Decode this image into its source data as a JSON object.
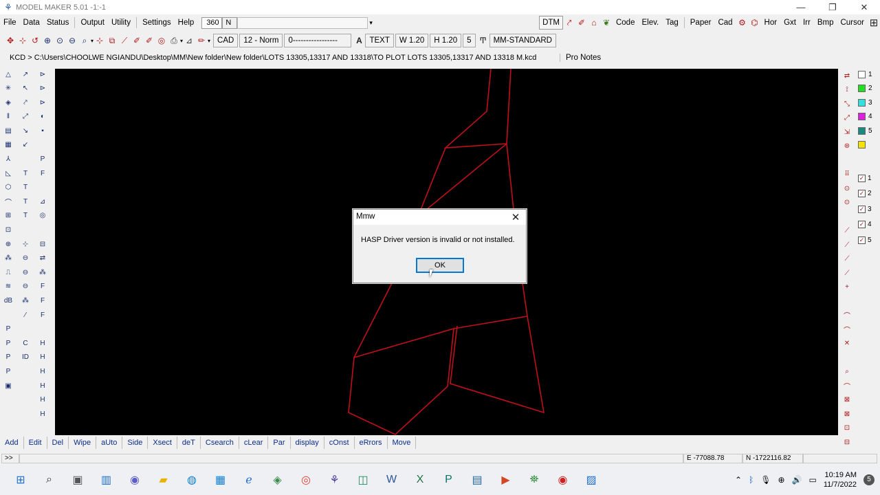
{
  "window": {
    "title": "MODEL MAKER  5.01    -1:-1",
    "app_icon": "model-maker-logo-icon",
    "controls": [
      "—",
      "❐",
      "✕"
    ]
  },
  "menubar": {
    "items": [
      "File",
      "Data",
      "Status",
      "Output",
      "Utility",
      "Settings",
      "Help"
    ],
    "zoom_value": "360",
    "north_value": "N"
  },
  "right_toolbar": {
    "dtm": "DTM",
    "code": "Code",
    "elev": "Elev.",
    "tag": "Tag",
    "paper": "Paper",
    "cad": "Cad",
    "hor": "Hor",
    "gxt": "Gxt",
    "irr": "Irr",
    "bmp": "Bmp",
    "cursor": "Cursor"
  },
  "toolbar2": {
    "cad_label": "CAD",
    "pen_label": "12 - Norm",
    "linestyle": "0-----------------",
    "text_label": "TEXT",
    "width_label": "W 1.20",
    "height_label": "H 1.20",
    "digits": "5",
    "style_label": "MM-STANDARD"
  },
  "pathbar": {
    "path": "KCD > C:\\Users\\CHOOLWE NGIANDU\\Desktop\\MM\\New folder\\New folder\\LOTS 13305,13317 AND 13318\\TO PLOT LOTS 13305,13317 AND 13318 M.kcd",
    "pro_notes": "Pro Notes"
  },
  "left_tools_a": [
    "△",
    "✳",
    "◈",
    "‖",
    "▤",
    "▦",
    "⅄",
    "◺",
    "⬡",
    "⌒",
    "⊞",
    "⊡",
    "⊕",
    "⁂",
    "⎍",
    "≋",
    "dB",
    "",
    "P",
    "P",
    "P",
    "P",
    "▣"
  ],
  "left_tools_b": [
    "↗",
    "↖",
    "⤤",
    "⤢",
    "↘",
    "↙",
    "",
    "T",
    "T",
    "T",
    "T",
    "",
    "⊹",
    "⊖",
    "⊖",
    "⊖",
    "⁂",
    "⁄",
    "",
    "C",
    "ID",
    "",
    ""
  ],
  "left_tools_c": [
    "⊳",
    "⊳",
    "⊳",
    "◐",
    "▪",
    "",
    "P",
    "F",
    "",
    "⊿",
    "◎",
    "",
    "⊟",
    "⇄",
    "⁂",
    "F",
    "F",
    "F",
    "",
    "H",
    "H",
    "H",
    "H",
    "H",
    "H"
  ],
  "right_tools": [
    "⇄",
    "⟟",
    "⤡",
    "⤢",
    "⇲",
    "⊛",
    "",
    "⠿",
    "⊙",
    "⊙",
    "",
    "⟋",
    "⟋",
    "⟋",
    "⟋",
    "+",
    "",
    "⌒",
    "⌒",
    "✕",
    "",
    "⌕",
    "⌒",
    "⊠",
    "⊠",
    "⊡",
    "⊟"
  ],
  "layers": [
    {
      "num": "1",
      "color": "#ffffff"
    },
    {
      "num": "2",
      "color": "#22dd22"
    },
    {
      "num": "3",
      "color": "#33e0e0"
    },
    {
      "num": "4",
      "color": "#dd22dd"
    },
    {
      "num": "5",
      "color": "#1a8a80"
    },
    {
      "num": "",
      "color": "#f5e200"
    }
  ],
  "checks": [
    "1",
    "2",
    "3",
    "4",
    "5"
  ],
  "plot": {
    "line_color": "#c0101a",
    "background": "#000000"
  },
  "command_buttons": [
    "Add",
    "Edit",
    "Del",
    "Wipe",
    "aUto",
    "Side",
    "Xsect",
    "deT",
    "Csearch",
    "cLear",
    "Par",
    "display",
    "cOnst",
    "eRrors",
    "Move"
  ],
  "status": {
    "prompt": ">>",
    "easting": "E -77088.78",
    "northing": "N -1722116.82"
  },
  "dialog": {
    "title": "Mmw",
    "message": "HASP Driver version is invalid or not installed.",
    "ok_label": "OK"
  },
  "taskbar": {
    "apps": [
      "windows-start-icon",
      "search-icon",
      "task-view-icon",
      "widgets-icon",
      "teams-chat-icon",
      "file-explorer-icon",
      "edge-icon",
      "store-icon",
      "internet-explorer-icon",
      "maps-icon",
      "chrome-icon",
      "model-maker-taskbar-icon",
      "image-viewer-icon",
      "word-icon",
      "excel-icon",
      "publisher-icon",
      "notepad-icon",
      "powerpoint-icon",
      "network-icon",
      "recorder-icon",
      "photos-icon"
    ],
    "time": "10:19 AM",
    "date": "11/7/2022",
    "notification_count": "5"
  }
}
